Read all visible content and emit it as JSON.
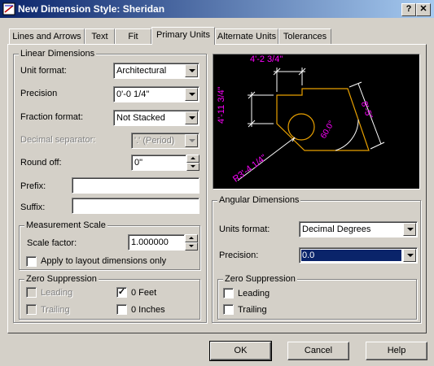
{
  "window": {
    "title": "New Dimension Style: Sheridan",
    "help_btn": "?",
    "close_btn": "✕"
  },
  "tabs": [
    {
      "label": "Lines and Arrows",
      "active": false
    },
    {
      "label": "Text",
      "active": false
    },
    {
      "label": "Fit",
      "active": false
    },
    {
      "label": "Primary Units",
      "active": true
    },
    {
      "label": "Alternate Units",
      "active": false
    },
    {
      "label": "Tolerances",
      "active": false
    }
  ],
  "linear": {
    "group_label": "Linear Dimensions",
    "unit_format": {
      "label": "Unit format:",
      "value": "Architectural"
    },
    "precision": {
      "label": "Precision",
      "value": "0'-0 1/4\""
    },
    "fraction_format": {
      "label": "Fraction format:",
      "value": "Not Stacked"
    },
    "decimal_separator": {
      "label": "Decimal separator:",
      "value": "'.' (Period)",
      "disabled": true
    },
    "round_off": {
      "label": "Round off:",
      "value": "0\""
    },
    "prefix": {
      "label": "Prefix:",
      "value": ""
    },
    "suffix": {
      "label": "Suffix:",
      "value": ""
    }
  },
  "measurement_scale": {
    "group_label": "Measurement Scale",
    "scale_factor": {
      "label": "Scale factor:",
      "value": "1.000000"
    },
    "apply_layout": {
      "label": "Apply to layout dimensions only",
      "checked": false
    }
  },
  "zero_suppression_linear": {
    "group_label": "Zero Suppression",
    "leading": {
      "label": "Leading",
      "checked": false,
      "disabled": true
    },
    "trailing": {
      "label": "Trailing",
      "checked": false,
      "disabled": true
    },
    "feet": {
      "label": "0 Feet",
      "checked": true
    },
    "inches": {
      "label": "0 Inches",
      "checked": false
    }
  },
  "preview": {
    "dim_top": "4'-2 3/4\"",
    "dim_left": "4'-11 3/4\"",
    "dim_right": "8'-5\"",
    "dim_angle": "60.0°",
    "dim_radius": "R3'-4 1/4\"",
    "colors": {
      "dim": "#ff00ff",
      "geometry": "#e8a000",
      "lines": "#ffffff"
    }
  },
  "angular": {
    "group_label": "Angular Dimensions",
    "units_format": {
      "label": "Units format:",
      "value": "Decimal Degrees"
    },
    "precision": {
      "label": "Precision:",
      "value": "0.0"
    }
  },
  "zero_suppression_angular": {
    "group_label": "Zero Suppression",
    "leading": {
      "label": "Leading",
      "checked": false
    },
    "trailing": {
      "label": "Trailing",
      "checked": false
    }
  },
  "buttons": {
    "ok": "OK",
    "cancel": "Cancel",
    "help": "Help"
  }
}
